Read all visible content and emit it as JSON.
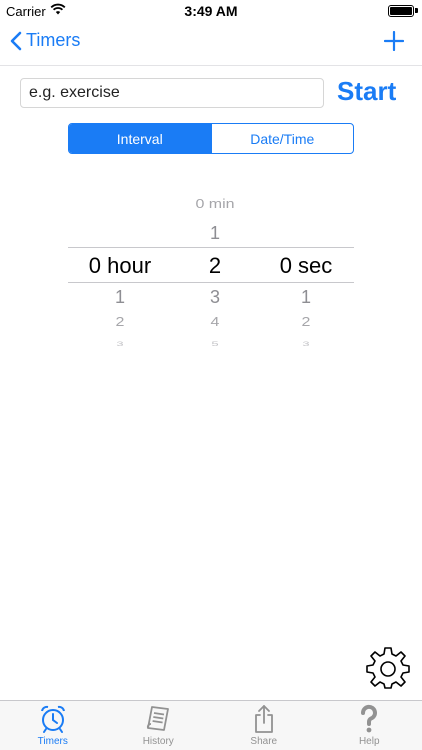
{
  "status_bar": {
    "carrier": "Carrier",
    "time": "3:49 AM"
  },
  "nav": {
    "back_label": "Timers"
  },
  "name_input": {
    "placeholder": "e.g. exercise"
  },
  "start_label": "Start",
  "segments": {
    "interval": "Interval",
    "date_time": "Date/Time"
  },
  "picker": {
    "hour": {
      "selected": "0 hour",
      "below": [
        "1",
        "2",
        "3"
      ]
    },
    "minute": {
      "above": [
        "0 min",
        "1"
      ],
      "selected": "2",
      "below": [
        "3",
        "4",
        "5"
      ]
    },
    "second": {
      "selected": "0 sec",
      "below": [
        "1",
        "2",
        "3"
      ]
    }
  },
  "tabs": {
    "timers": "Timers",
    "history": "History",
    "share": "Share",
    "help": "Help"
  },
  "colors": {
    "accent": "#1a7cf5",
    "tab_inactive": "#929292"
  }
}
